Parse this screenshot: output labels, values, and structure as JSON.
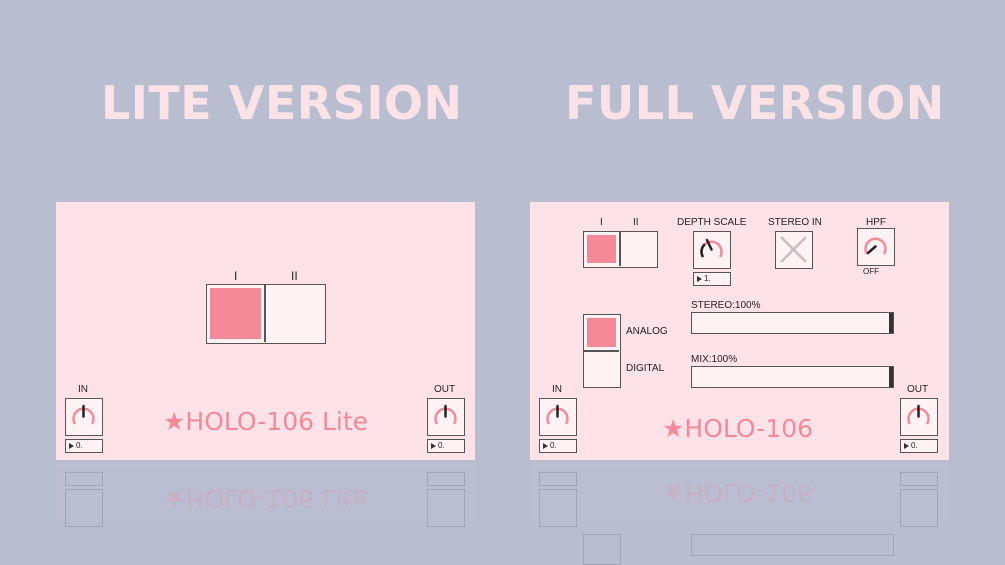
{
  "headings": {
    "lite": "LITE VERSION",
    "full": "FULL VERSION"
  },
  "lite": {
    "mode_labels": [
      "I",
      "II"
    ],
    "in_label": "IN",
    "out_label": "OUT",
    "in_value": "0.",
    "out_value": "0.",
    "brand": "★HOLO-106 Lite"
  },
  "full": {
    "mode_labels": [
      "I",
      "II"
    ],
    "depth_scale_label": "DEPTH SCALE",
    "depth_scale_value": "1.",
    "stereo_in_label": "STEREO IN",
    "hpf_label": "HPF",
    "hpf_value": "OFF",
    "analog_label": "ANALOG",
    "digital_label": "DIGITAL",
    "stereo_label": "STEREO:100%",
    "stereo_level": 1.0,
    "mix_label": "MIX:100%",
    "mix_level": 1.0,
    "in_label": "IN",
    "out_label": "OUT",
    "in_value": "0.",
    "out_value": "0.",
    "brand": "★HOLO-106"
  },
  "colors": {
    "background": "#b8bdd0",
    "panel": "#fde2e7",
    "accent": "#f48a98",
    "selected": "#f48a98",
    "heading": "#fbe2e7"
  },
  "icons": {
    "knob": "knob-dial-icon",
    "stereo_in": "x-toggle-icon",
    "number": "play-triangle-icon"
  }
}
